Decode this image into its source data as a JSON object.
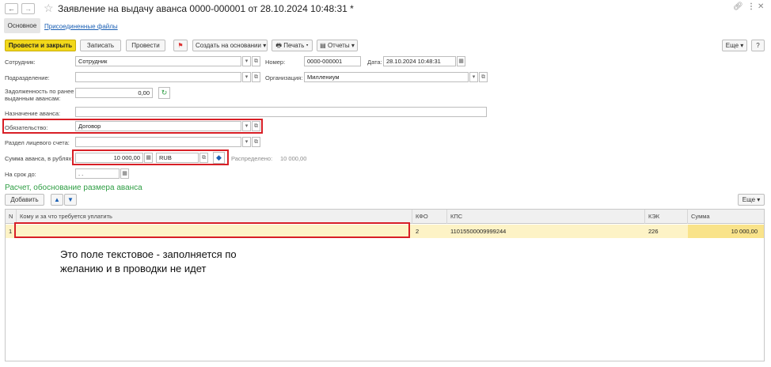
{
  "window": {
    "nav_back": "←",
    "nav_forward": "→",
    "title": "Заявление на выдачу аванса 0000-000001 от 28.10.2024 10:48:31 *"
  },
  "tabs": [
    {
      "label": "Основное"
    },
    {
      "label": "Присоединенные файлы"
    }
  ],
  "toolbar": {
    "post_close": "Провести и закрыть",
    "save": "Записать",
    "post": "Провести",
    "create_based": "Создать на основании",
    "print": "Печать",
    "reports": "Отчеты",
    "more": "Еще"
  },
  "form": {
    "employee_label": "Сотрудник:",
    "employee_value": "Сотрудник",
    "number_label": "Номер:",
    "number_value": "0000-000001",
    "date_label": "Дата:",
    "date_value": "28.10.2024 10:48:31",
    "department_label": "Подразделение:",
    "department_value": "",
    "organization_label": "Организация:",
    "organization_value": "Миллениум",
    "debt_label_line1": "Задолженность по ранее",
    "debt_label_line2": "выданным авансам:",
    "debt_value": "0,00",
    "purpose_label": "Назначение аванса:",
    "purpose_value": "",
    "obligation_label": "Обязательство:",
    "obligation_value": "Договор",
    "account_section_label": "Раздел лицевого счета:",
    "account_section_value": "",
    "amount_label": "Сумма аванса, в рублях:",
    "amount_value": "10 000,00",
    "currency_value": "RUB",
    "distributed_label": "Распределено:",
    "distributed_value": "10 000,00",
    "term_label": "На срок до:",
    "term_value": " .  .  "
  },
  "section": {
    "title": "Расчет, обоснование размера аванса",
    "add_button": "Добавить",
    "more": "Еще"
  },
  "table": {
    "columns": [
      "N",
      "Кому и за что требуется уплатить",
      "КФО",
      "КПС",
      "КЭК",
      "Сумма"
    ],
    "rows": [
      {
        "n": "1",
        "payee": "",
        "kfo": "2",
        "kps": "11015500009999244",
        "kek": "226",
        "sum": "10 000,00"
      }
    ]
  },
  "annotation": {
    "line1": "Это поле текстовое - заполняется по",
    "line2": "желанию и в проводки не идет"
  },
  "colors": {
    "primary_button": "#f2d81a",
    "highlight_border": "#d81f26",
    "section_title": "#2f9e44",
    "row_highlight": "#fdf3c6"
  }
}
